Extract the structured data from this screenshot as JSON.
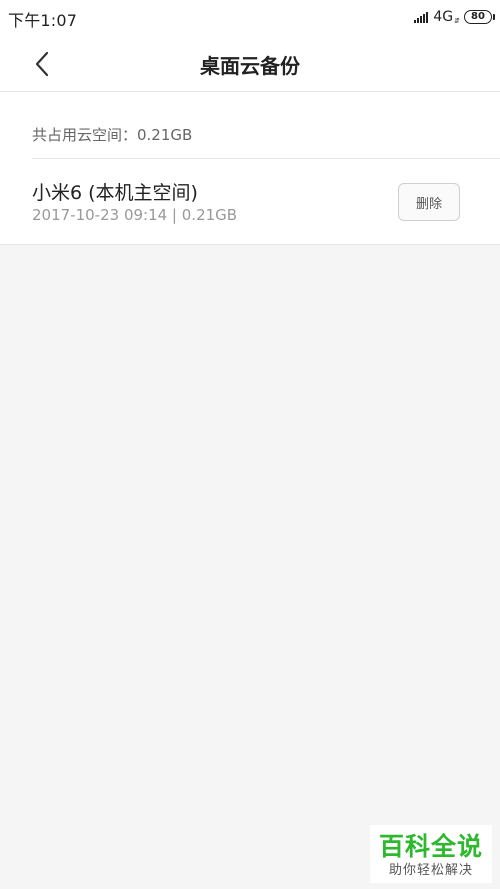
{
  "status_bar": {
    "time": "下午1:07",
    "network": "4G",
    "network_arrows": "⇵",
    "battery": "80",
    "icons": [
      "signal-icon",
      "battery-icon"
    ]
  },
  "header": {
    "title": "桌面云备份",
    "back_icon": "chevron-left-icon"
  },
  "summary": {
    "usage_text": "共占用云空间：0.21GB"
  },
  "backups": [
    {
      "device": "小米6 (本机主空间)",
      "meta": "2017-10-23 09:14 | 0.21GB",
      "delete_label": "删除"
    }
  ],
  "watermark": {
    "main": "百科全说",
    "sub": "助你轻松解决"
  },
  "colors": {
    "background": "#f5f5f5",
    "card": "#ffffff",
    "watermark_green": "#2eb82e"
  }
}
